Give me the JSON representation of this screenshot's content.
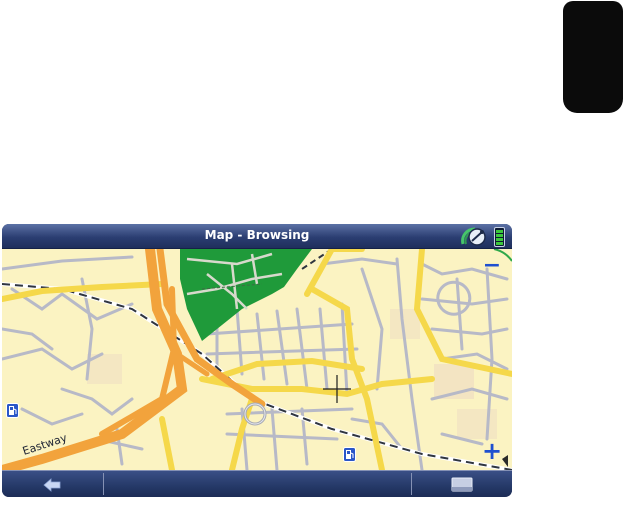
{
  "header": {
    "title": "Map - Browsing"
  },
  "map": {
    "road_labels": [
      "Eastway"
    ],
    "poi": [
      {
        "icon": "fuel-station-icon"
      },
      {
        "icon": "fuel-station-icon"
      }
    ],
    "cursor": {
      "icon": "crosshair-icon"
    },
    "position_marker": {
      "icon": "position-ring-icon"
    }
  },
  "status_icons": {
    "gps": "satellite-dish-icon",
    "battery": "battery-icon"
  },
  "controls": {
    "zoom_out": "−",
    "zoom_in": "+"
  },
  "toolbar": {
    "back_icon": "back-arrow-icon",
    "menu_icon": "menu-icon",
    "status_text": ""
  },
  "colors": {
    "map_background": "#fbf3c2",
    "major_road": "#f5d84a",
    "motorway": "#f2a33c",
    "minor_road": "#b7b9c7",
    "park": "#1f9a3a",
    "railway": "#2f3540",
    "frame": "#20305a",
    "accent_blue": "#1e4fd0"
  }
}
